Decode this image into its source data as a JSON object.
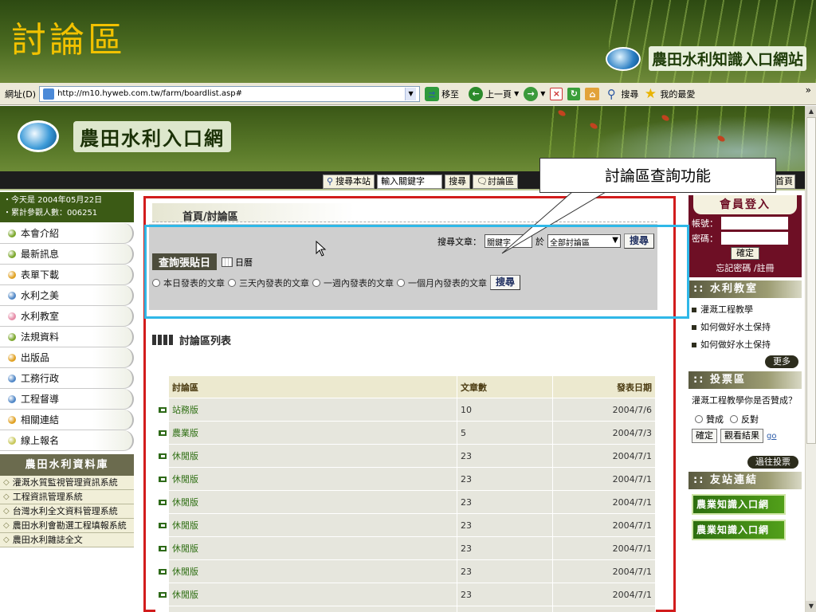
{
  "slide": {
    "title": "討論區",
    "brand": "農田水利知識入口網站"
  },
  "browser": {
    "address_label": "網址(D)",
    "url": "http://m10.hyweb.com.tw/farm/boardlist.asp#",
    "go": "移至",
    "back": "上一頁",
    "search": "搜尋",
    "favorites": "我的最愛",
    "more": "»"
  },
  "site": {
    "name": "農田水利入口網",
    "tools": {
      "search_site": "搜尋本站",
      "keyword": "輸入關鍵字",
      "search": "搜尋",
      "forum": "討論區",
      "home": "首頁"
    },
    "info": {
      "today": "・今天是 2004年05月22日",
      "visitors": "・累計參觀人數：006251"
    },
    "menu": [
      {
        "label": "本會介紹",
        "color": "#7aa62a"
      },
      {
        "label": "最新訊息",
        "color": "#7aa62a"
      },
      {
        "label": "表單下載",
        "color": "#e0a020"
      },
      {
        "label": "水利之美",
        "color": "#4f86c6"
      },
      {
        "label": "水利教室",
        "color": "#e68aa6"
      },
      {
        "label": "法規資料",
        "color": "#7aa62a"
      },
      {
        "label": "出版品",
        "color": "#e0a020"
      },
      {
        "label": "工務行政",
        "color": "#4f86c6"
      },
      {
        "label": "工程督導",
        "color": "#4f86c6"
      },
      {
        "label": "相關連結",
        "color": "#e0a020"
      },
      {
        "label": "線上報名",
        "color": "#c8c85a"
      }
    ],
    "db_title": "農田水利資料庫",
    "db_items": [
      "灌溉水質監視管理資訊系統",
      "工程資訊管理系統",
      "台灣水利全文資料管理系統",
      "農田水利會勘選工程填報系統",
      "農田水利雜誌全文"
    ]
  },
  "main": {
    "breadcrumb": "首頁/討論區",
    "query": {
      "search_label": "搜尋文章：",
      "keyword": "關鍵字",
      "in": "於",
      "scope": "全部討論區",
      "search_btn": "搜尋",
      "title": "查詢張貼日",
      "calendar": "日曆",
      "options": [
        "本日發表的文章",
        "三天內發表的文章",
        "一週內發表的文章",
        "一個月內發表的文章"
      ],
      "search_btn2": "搜尋"
    },
    "list_title": "討論區列表",
    "columns": [
      "討論區",
      "文章數",
      "發表日期"
    ],
    "rows": [
      {
        "name": "站務版",
        "count": "10",
        "date": "2004/7/6"
      },
      {
        "name": "農業版",
        "count": "5",
        "date": "2004/7/3"
      },
      {
        "name": "休閒版",
        "count": "23",
        "date": "2004/7/1"
      },
      {
        "name": "休閒版",
        "count": "23",
        "date": "2004/7/1"
      },
      {
        "name": "休閒版",
        "count": "23",
        "date": "2004/7/1"
      },
      {
        "name": "休閒版",
        "count": "23",
        "date": "2004/7/1"
      },
      {
        "name": "休閒版",
        "count": "23",
        "date": "2004/7/1"
      },
      {
        "name": "休閒版",
        "count": "23",
        "date": "2004/7/1"
      },
      {
        "name": "休閒版",
        "count": "23",
        "date": "2004/7/1"
      },
      {
        "name": "休閒版",
        "count": "23",
        "date": "2004/7/1"
      }
    ]
  },
  "right": {
    "login_title": "會員登入",
    "account": "帳號：",
    "password": "密碼：",
    "ok": "確定",
    "forgot": "忘記密碼 /註冊",
    "class_title": "水利教室",
    "class_items": [
      "灌溉工程教學",
      "如何做好水土保持",
      "如何做好水土保持"
    ],
    "more": "更多",
    "vote_title": "投票區",
    "vote_q": "灌溉工程教學你是否贊成？",
    "vote_yes": "贊成",
    "vote_no": "反對",
    "vote_ok": "確定",
    "vote_result": "觀看結果",
    "vote_go": "go",
    "vote_past": "過往投票",
    "links_title": "友站連結",
    "link1": "農業知識入口網",
    "link2": "農業知識入口網"
  },
  "callout": "討論區查詢功能"
}
